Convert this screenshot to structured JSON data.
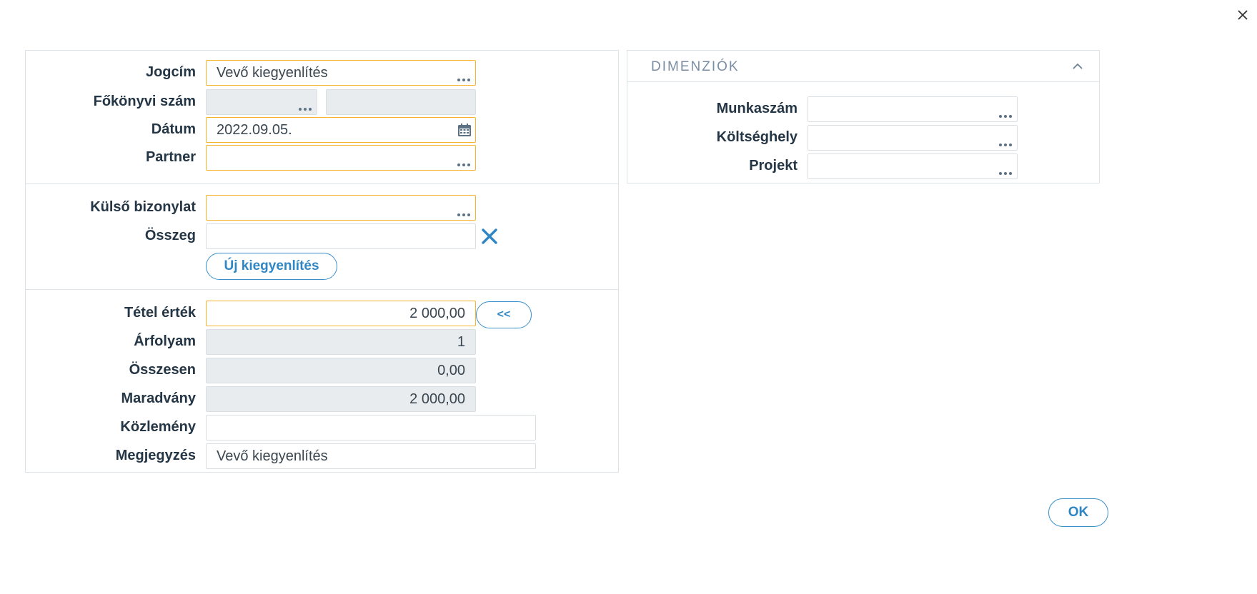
{
  "dialog": {
    "close_icon": "close-icon",
    "ok_label": "OK"
  },
  "main": {
    "jogcim": {
      "label": "Jogcím",
      "value": "Vevő kiegyenlítés"
    },
    "fokonyvi": {
      "label": "Főkönyvi szám",
      "value": "",
      "value2": ""
    },
    "datum": {
      "label": "Dátum",
      "value": "2022.09.05."
    },
    "partner": {
      "label": "Partner",
      "value": ""
    },
    "kulso": {
      "label": "Külső bizonylat",
      "value": ""
    },
    "osszeg": {
      "label": "Összeg",
      "value": ""
    },
    "uj_kiegyenlites_label": "Új kiegyenlítés",
    "tetel_ertek": {
      "label": "Tétel érték",
      "value": "2 000,00"
    },
    "transfer_label": "<<",
    "arfolyam": {
      "label": "Árfolyam",
      "value": "1"
    },
    "osszesen": {
      "label": "Összesen",
      "value": "0,00"
    },
    "maradvany": {
      "label": "Maradvány",
      "value": "2 000,00"
    },
    "kozlemeny": {
      "label": "Közlemény",
      "value": ""
    },
    "megjegyzes": {
      "label": "Megjegyzés",
      "value": "Vevő kiegyenlítés"
    }
  },
  "dimensions": {
    "title": "DIMENZIÓK",
    "munkaszam": {
      "label": "Munkaszám",
      "value": ""
    },
    "koltseghely": {
      "label": "Költséghely",
      "value": ""
    },
    "projekt": {
      "label": "Projekt",
      "value": ""
    }
  },
  "colors": {
    "required_border": "#f6b42c",
    "readonly_bg": "#e9ecef",
    "accent": "#2e86c4",
    "label_text": "#243645"
  }
}
